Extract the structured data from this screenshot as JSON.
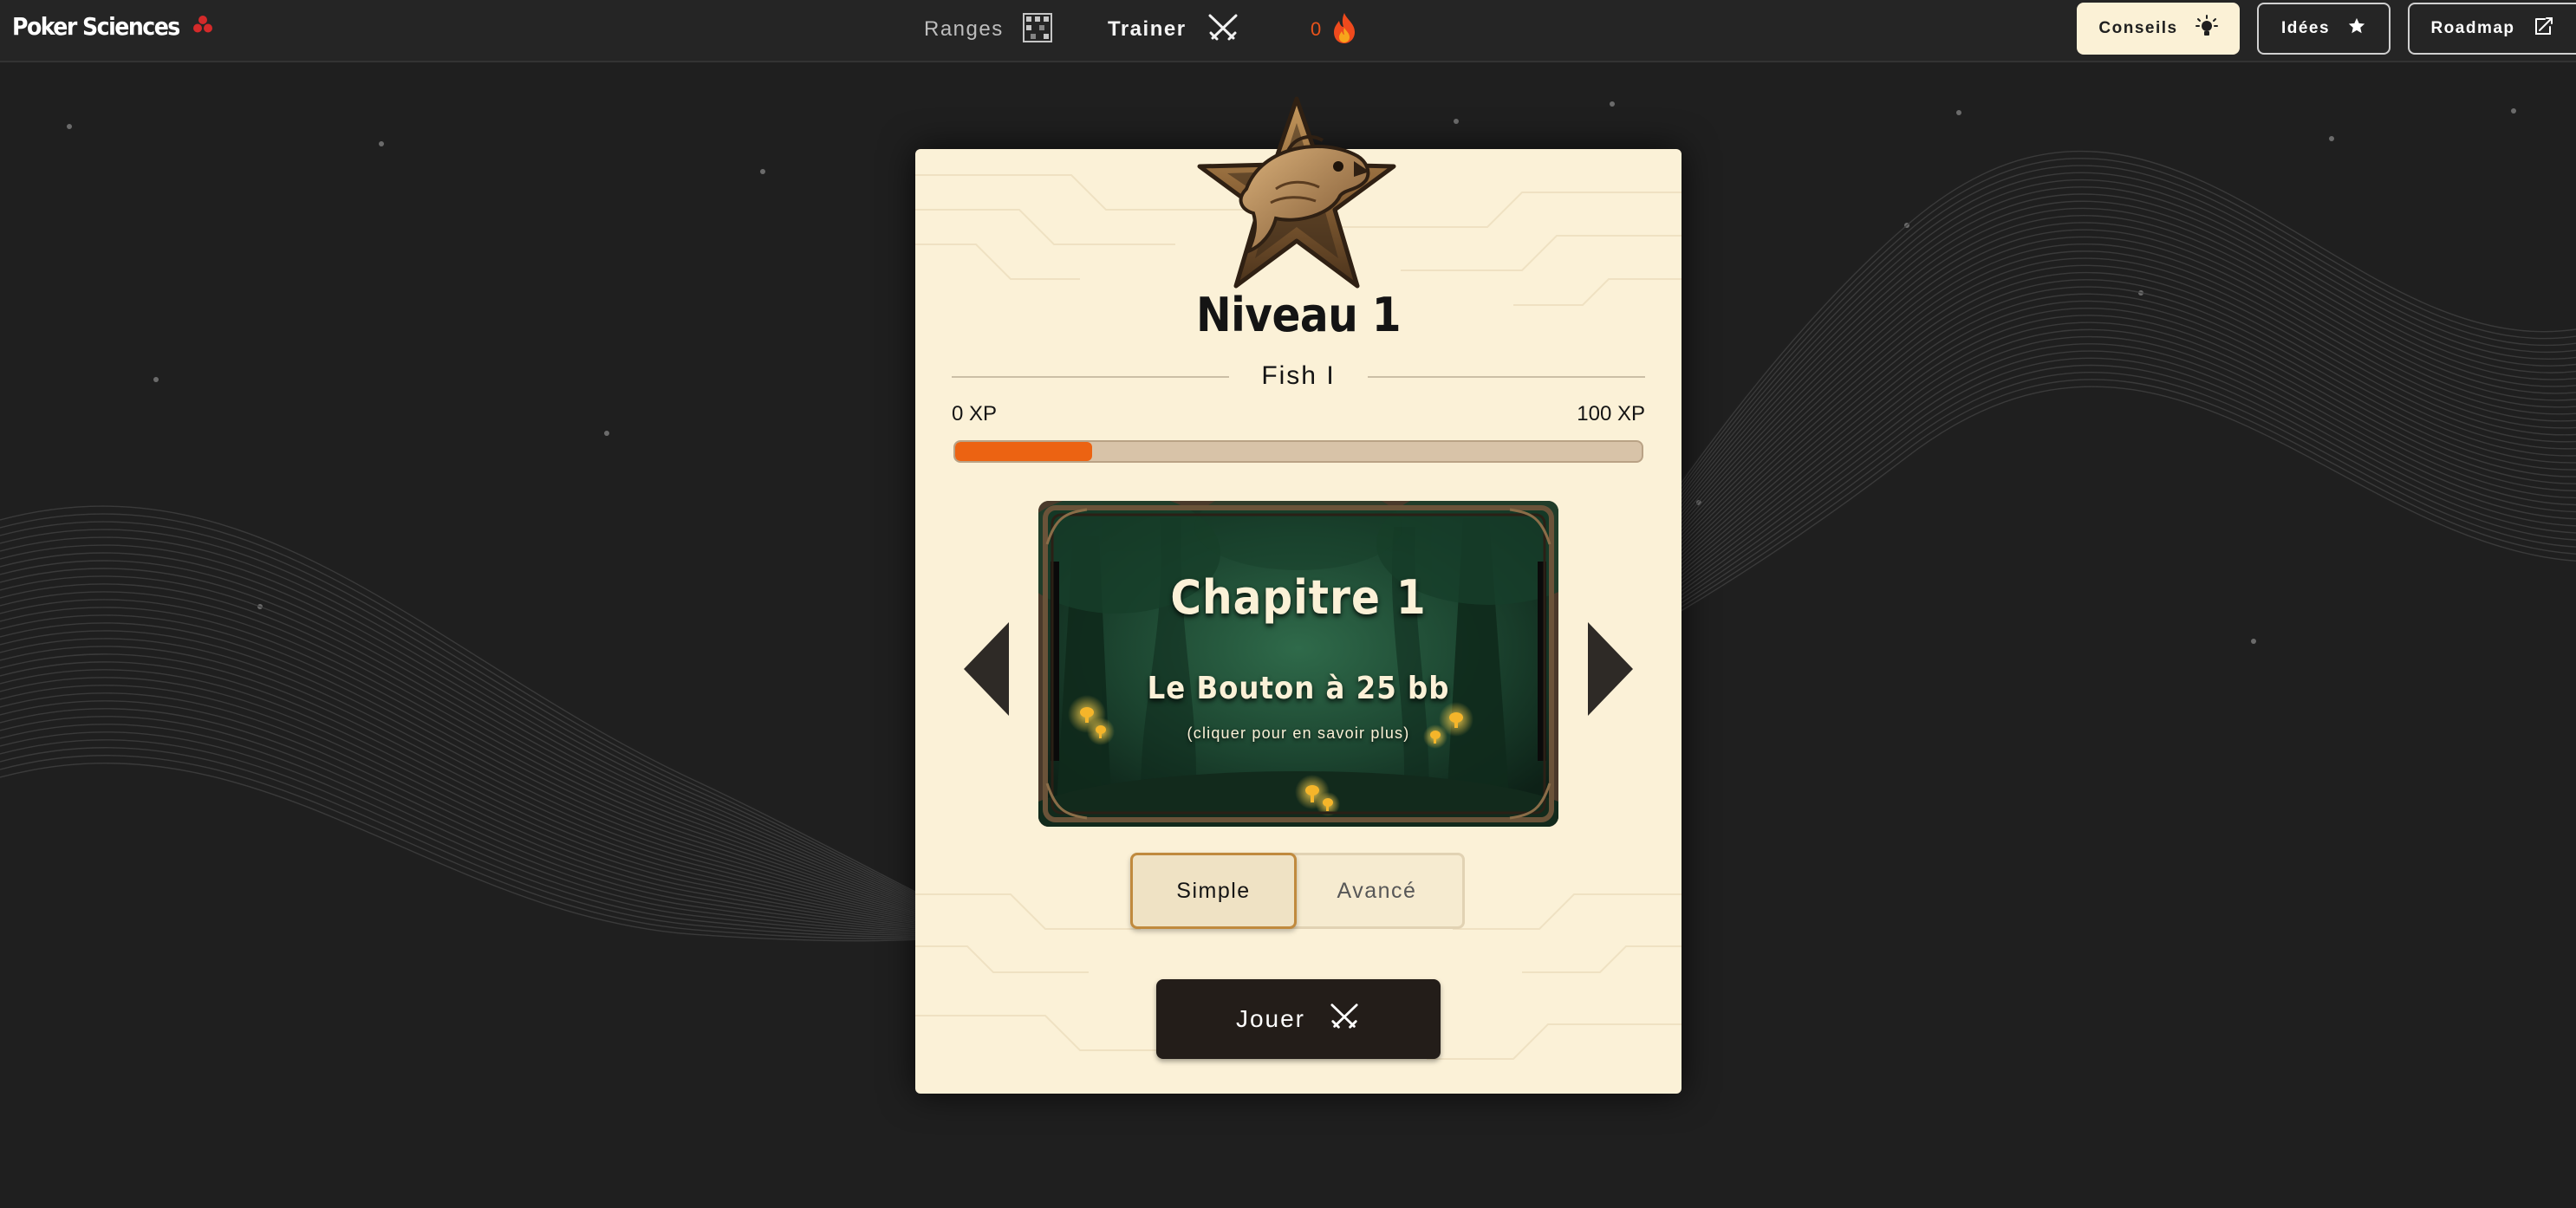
{
  "brand": {
    "name": "Poker Sciences"
  },
  "nav": {
    "ranges_label": "Ranges",
    "trainer_label": "Trainer",
    "streak_count": "0"
  },
  "header_buttons": {
    "conseils": "Conseils",
    "idees": "Idées",
    "roadmap": "Roadmap"
  },
  "level": {
    "title": "Niveau 1",
    "rank_name": "Fish I",
    "xp_min_label": "0 XP",
    "xp_max_label": "100 XP",
    "xp_progress_fraction": 0.2
  },
  "chapter": {
    "title": "Chapitre 1",
    "subtitle": "Le Bouton à 25 bb",
    "hint": "(cliquer pour en savoir plus)"
  },
  "modes": {
    "simple": "Simple",
    "advanced": "Avancé",
    "selected": "Simple"
  },
  "play_button": {
    "label": "Jouer"
  },
  "icons": {
    "brand": "clubs-icon",
    "ranges": "grid-icon",
    "trainer": "crossed-swords-icon",
    "streak": "flame-icon",
    "conseils": "lightbulb-icon",
    "idees": "star-icon",
    "roadmap": "external-note-icon",
    "badge": "fish-star-badge-icon",
    "play": "crossed-swords-icon"
  },
  "colors": {
    "page_bg": "#1f1f1f",
    "topbar_bg": "#252525",
    "card_bg": "#fbf1d7",
    "accent_orange": "#ec6312",
    "brand_red": "#d42a2a",
    "conseils_bg": "#fbf1d6",
    "play_bg": "#231d19"
  }
}
